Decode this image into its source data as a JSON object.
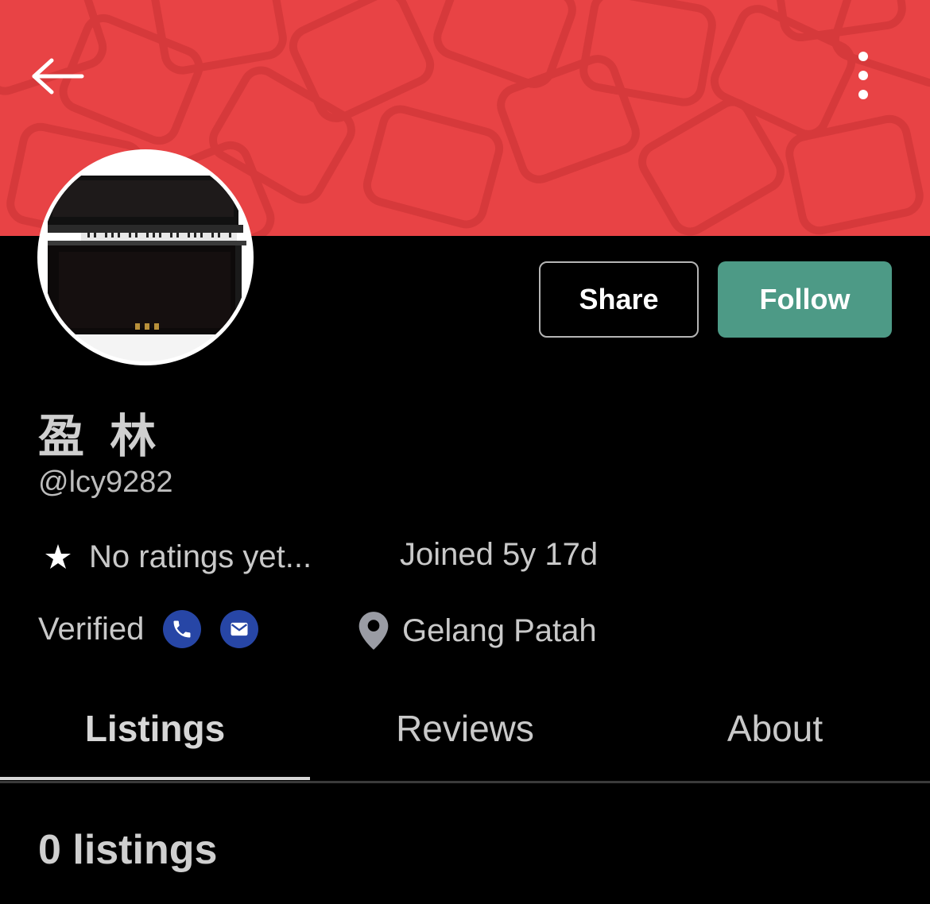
{
  "colors": {
    "banner": "#e84345",
    "follow_button": "#4d9a86",
    "contact_icon_bg": "#2746a6",
    "background": "#000000"
  },
  "header": {
    "back_icon": "arrow-left-icon",
    "more_icon": "more-vertical-icon"
  },
  "profile": {
    "avatar_description": "piano-photo",
    "display_name": "盈 林",
    "handle": "@lcy9282",
    "ratings_text": "No ratings yet...",
    "joined_text": "Joined 5y 17d",
    "verified_label": "Verified",
    "location": "Gelang Patah"
  },
  "actions": {
    "share_label": "Share",
    "follow_label": "Follow"
  },
  "tabs": [
    {
      "label": "Listings",
      "active": true
    },
    {
      "label": "Reviews",
      "active": false
    },
    {
      "label": "About",
      "active": false
    }
  ],
  "listings": {
    "count_text": "0 listings"
  }
}
